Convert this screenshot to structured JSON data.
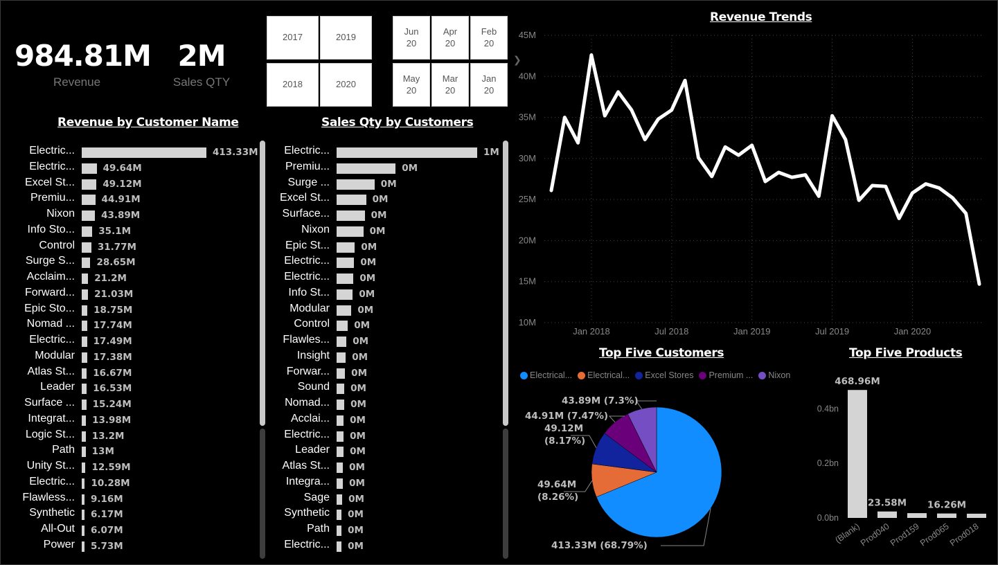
{
  "kpis": {
    "revenue": {
      "value": "984.81M",
      "label": "Revenue"
    },
    "sales_qty": {
      "value": "2M",
      "label": "Sales QTY"
    }
  },
  "year_slicer": [
    "2017",
    "2019",
    "2018",
    "2020"
  ],
  "month_slicer": [
    {
      "month": "Jun",
      "year": "20"
    },
    {
      "month": "Apr",
      "year": "20"
    },
    {
      "month": "Feb",
      "year": "20"
    },
    {
      "month": "May",
      "year": "20"
    },
    {
      "month": "Mar",
      "year": "20"
    },
    {
      "month": "Jan",
      "year": "20"
    }
  ],
  "nav_arrow": "chevron-right-icon",
  "colors": {
    "background": "#000000",
    "bar": "#d4d4d4",
    "data_label": "#bdbdbd",
    "pie": [
      "#118dff",
      "#e66c37",
      "#12239e",
      "#6b007b",
      "#744ec2"
    ]
  },
  "chart_data": [
    {
      "type": "bar",
      "orientation": "horizontal",
      "title": "Revenue by Customer Name",
      "categories": [
        "Electric...",
        "Electric...",
        "Excel St...",
        "Premiu...",
        "Nixon",
        "Info Sto...",
        "Control",
        "Surge S...",
        "Acclaim...",
        "Forward...",
        "Epic Sto...",
        "Nomad ...",
        "Electric...",
        "Modular",
        "Atlas St...",
        "Leader",
        "Surface ...",
        "Integrat...",
        "Logic St...",
        "Path",
        "Unity St...",
        "Electric...",
        "Flawless...",
        "Synthetic",
        "All-Out",
        "Power"
      ],
      "values": [
        413.33,
        49.64,
        49.12,
        44.91,
        43.89,
        35.1,
        31.77,
        28.65,
        21.2,
        21.03,
        18.75,
        17.74,
        17.49,
        17.38,
        16.67,
        16.53,
        15.24,
        13.98,
        13.2,
        13.0,
        12.59,
        10.28,
        9.16,
        6.17,
        6.07,
        5.73
      ],
      "labels": [
        "413.33M",
        "49.64M",
        "49.12M",
        "44.91M",
        "43.89M",
        "35.1M",
        "31.77M",
        "28.65M",
        "21.2M",
        "21.03M",
        "18.75M",
        "17.74M",
        "17.49M",
        "17.38M",
        "16.67M",
        "16.53M",
        "15.24M",
        "13.98M",
        "13.2M",
        "13M",
        "12.59M",
        "10.28M",
        "9.16M",
        "6.17M",
        "6.07M",
        "5.73M"
      ],
      "unit": "M"
    },
    {
      "type": "bar",
      "orientation": "horizontal",
      "title": "Sales Qty by Customers",
      "categories": [
        "Electric...",
        "Premiu...",
        "Surge ...",
        "Excel St...",
        "Surface...",
        "Nixon",
        "Epic St...",
        "Electric...",
        "Electric...",
        "Info St...",
        "Modular",
        "Control",
        "Flawles...",
        "Insight",
        "Forwar...",
        "Sound",
        "Nomad...",
        "Acclai...",
        "Electric...",
        "Leader",
        "Atlas St...",
        "Integra...",
        "Sage",
        "Synthetic",
        "Path",
        "Electric..."
      ],
      "values": [
        1.0,
        0.42,
        0.27,
        0.21,
        0.2,
        0.19,
        0.13,
        0.125,
        0.12,
        0.115,
        0.105,
        0.08,
        0.07,
        0.065,
        0.06,
        0.055,
        0.055,
        0.05,
        0.05,
        0.05,
        0.045,
        0.045,
        0.04,
        0.035,
        0.035,
        0.035
      ],
      "labels": [
        "1M",
        "0M",
        "0M",
        "0M",
        "0M",
        "0M",
        "0M",
        "0M",
        "0M",
        "0M",
        "0M",
        "0M",
        "0M",
        "0M",
        "0M",
        "0M",
        "0M",
        "0M",
        "0M",
        "0M",
        "0M",
        "0M",
        "0M",
        "0M",
        "0M",
        "0M"
      ],
      "unit": "M"
    },
    {
      "type": "line",
      "title": "Revenue Trends",
      "x": [
        "2017-10",
        "2017-11",
        "2017-12",
        "2018-01",
        "2018-02",
        "2018-03",
        "2018-04",
        "2018-05",
        "2018-06",
        "2018-07",
        "2018-08",
        "2018-09",
        "2018-10",
        "2018-11",
        "2018-12",
        "2019-01",
        "2019-02",
        "2019-03",
        "2019-04",
        "2019-05",
        "2019-06",
        "2019-07",
        "2019-08",
        "2019-09",
        "2019-10",
        "2019-11",
        "2019-12",
        "2020-01",
        "2020-02",
        "2020-03",
        "2020-04",
        "2020-05",
        "2020-06"
      ],
      "values": [
        26.1,
        35.0,
        31.9,
        42.6,
        35.2,
        38.1,
        35.9,
        32.3,
        34.8,
        35.9,
        39.5,
        30.1,
        27.8,
        31.4,
        30.4,
        31.6,
        27.2,
        28.3,
        27.7,
        28.0,
        25.4,
        35.2,
        32.3,
        24.9,
        26.7,
        26.6,
        22.7,
        25.8,
        26.9,
        26.4,
        25.2,
        23.3,
        14.7
      ],
      "yticks": [
        "10M",
        "15M",
        "20M",
        "25M",
        "30M",
        "35M",
        "40M",
        "45M"
      ],
      "xticks": [
        "Jan 2018",
        "Jul 2018",
        "Jan 2019",
        "Jul 2019",
        "Jan 2020"
      ],
      "ylim": [
        10,
        45
      ],
      "grid": true
    },
    {
      "type": "pie",
      "title": "Top Five Customers",
      "legend": [
        "Electrical...",
        "Electrical...",
        "Excel Stores",
        "Premium ...",
        "Nixon"
      ],
      "legend_position": "top",
      "values": [
        413.33,
        49.64,
        49.12,
        44.91,
        43.89
      ],
      "labels": [
        "413.33M (68.79%)",
        "49.64M (8.26%)",
        "49.12M (8.17%)",
        "44.91M (7.47%)",
        "43.89M (7.3%)"
      ]
    },
    {
      "type": "bar",
      "title": "Top Five Products",
      "categories": [
        "(Blank)",
        "Prod040",
        "Prod159",
        "Prod065",
        "Prod018"
      ],
      "values": [
        0.46896,
        0.02358,
        0.0175,
        0.01626,
        0.0155
      ],
      "labels": [
        "468.96M",
        "23.58M",
        "",
        "16.26M",
        ""
      ],
      "yticks": [
        "0.0bn",
        "0.2bn",
        "0.4bn"
      ],
      "ylim": [
        0,
        0.5
      ]
    }
  ]
}
